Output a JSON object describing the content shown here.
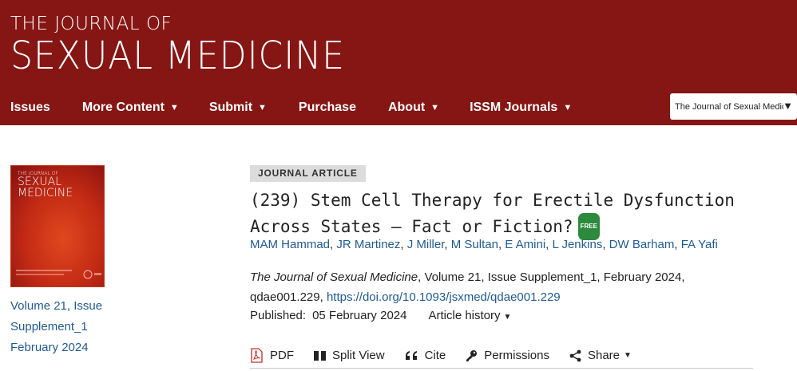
{
  "header": {
    "logo_line1": "THE JOURNAL OF",
    "logo_line2": "SEXUAL MEDICINE",
    "brand_color": "#861614"
  },
  "nav": {
    "items": [
      {
        "label": "Issues",
        "has_dropdown": false
      },
      {
        "label": "More Content",
        "has_dropdown": true
      },
      {
        "label": "Submit",
        "has_dropdown": true
      },
      {
        "label": "Purchase",
        "has_dropdown": false
      },
      {
        "label": "About",
        "has_dropdown": true
      },
      {
        "label": "ISSM Journals",
        "has_dropdown": true
      }
    ],
    "journal_select": "The Journal of Sexual Medicine"
  },
  "cover": {
    "title_line1": "THE JOURNAL OF",
    "title_line2": "SEXUAL",
    "title_line3": "MEDICINE"
  },
  "issue": {
    "line1": "Volume 21, Issue",
    "line2": "Supplement_1",
    "line3": "February 2024"
  },
  "article": {
    "type": "JOURNAL ARTICLE",
    "title": "(239) Stem Cell Therapy for Erectile Dysfunction Across States – Fact or Fiction?",
    "free_badge": "FREE",
    "authors": [
      "MAM Hammad",
      "JR Martinez",
      "J Miller",
      "M Sultan",
      "E Amini",
      "L Jenkins",
      "DW Barham",
      "FA Yafi"
    ],
    "journal_name": "The Journal of Sexual Medicine",
    "citation_rest": ", Volume 21, Issue Supplement_1, February 2024, qdae001.229, ",
    "doi": "https://doi.org/10.1093/jsxmed/qdae001.229",
    "published_label": "Published:",
    "published_date": "05 February 2024",
    "history_label": "Article history"
  },
  "toolbar": {
    "pdf": "PDF",
    "split_view": "Split View",
    "cite": "Cite",
    "permissions": "Permissions",
    "share": "Share"
  },
  "colors": {
    "link": "#1f5a94",
    "free_badge": "#2d8a3d",
    "article_type_bg": "#dcdcdc"
  }
}
